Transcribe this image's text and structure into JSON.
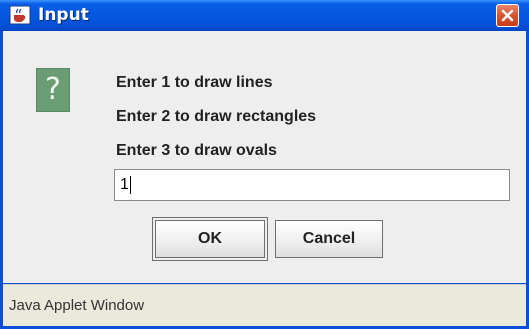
{
  "window": {
    "title": "Input",
    "title_icon": "java-cup-icon",
    "close_icon": "close-icon",
    "titlebar_color": "#0556e0",
    "close_button_color": "#d6532f"
  },
  "dialog": {
    "icon": "question-icon",
    "icon_glyph": "?",
    "icon_color": "#6a9d73",
    "messages": [
      "Enter 1 to draw lines",
      "Enter 2 to draw rectangles",
      "Enter 3 to draw ovals"
    ],
    "input_value": "1",
    "buttons": {
      "ok_label": "OK",
      "cancel_label": "Cancel"
    }
  },
  "status": {
    "text": "Java Applet Window"
  }
}
